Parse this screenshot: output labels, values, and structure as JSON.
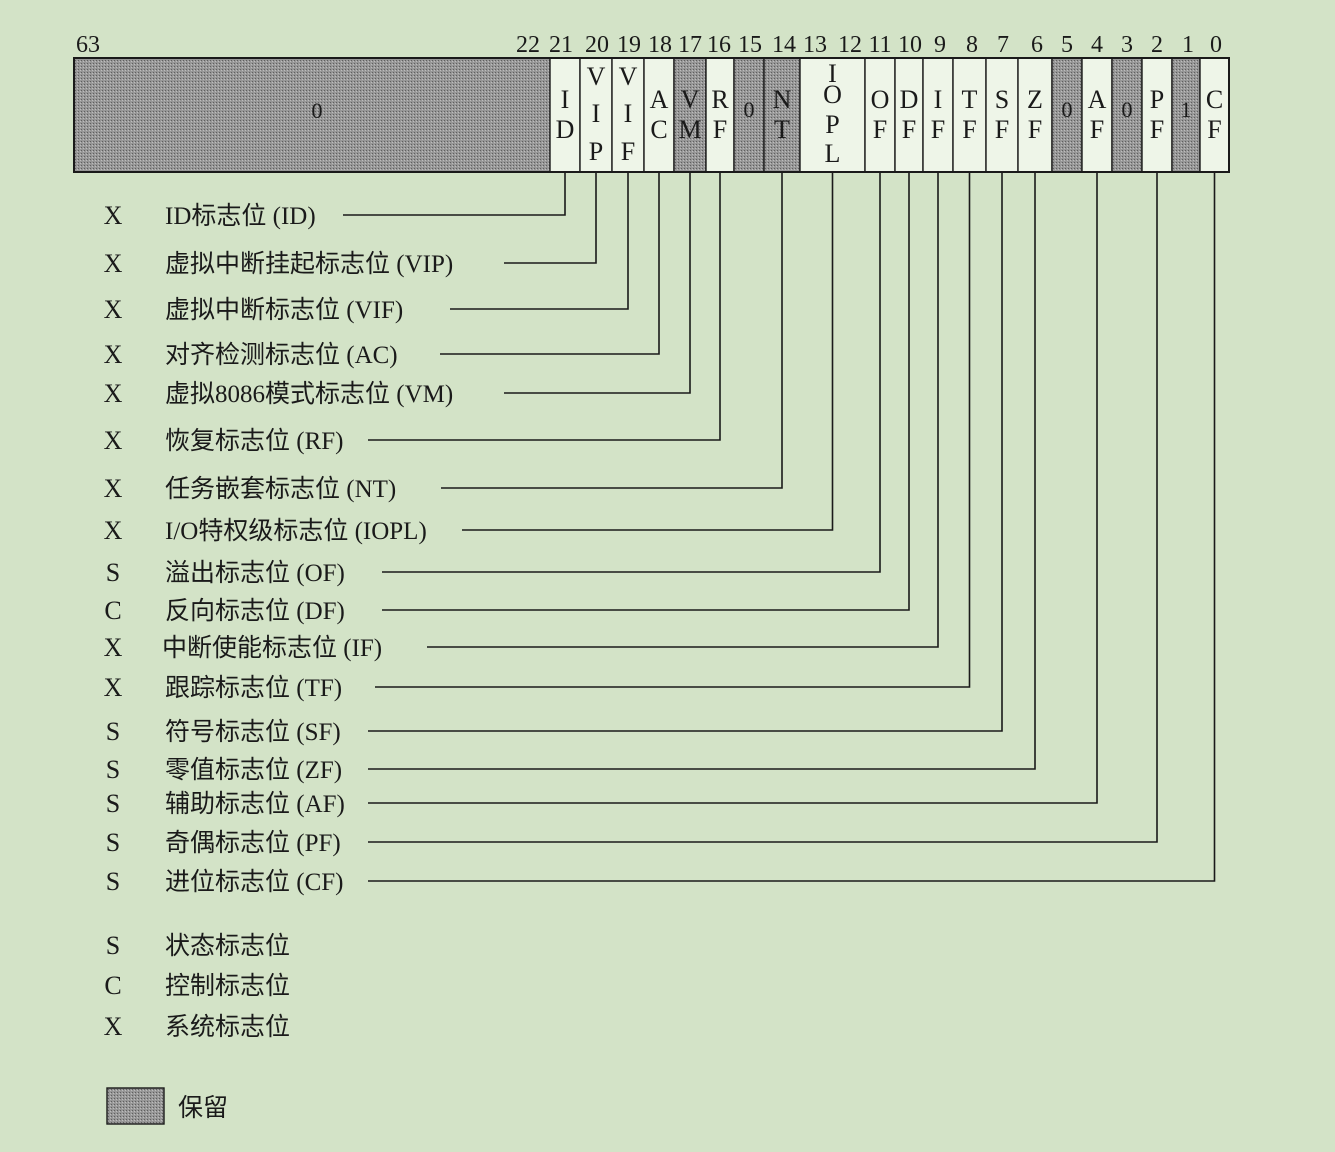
{
  "bit_numbers": [
    "63",
    "22",
    "21",
    "20",
    "19",
    "18",
    "17",
    "16",
    "15",
    "14",
    "13",
    "12",
    "11",
    "10",
    "9",
    "8",
    "7",
    "6",
    "5",
    "4",
    "3",
    "2",
    "1",
    "0"
  ],
  "register": {
    "reserved_high_value": "0",
    "fields": [
      {
        "letters": [
          "I",
          "D"
        ],
        "reserved": false
      },
      {
        "letters": [
          "V",
          "I",
          "P"
        ],
        "reserved": false
      },
      {
        "letters": [
          "V",
          "I",
          "F"
        ],
        "reserved": false
      },
      {
        "letters": [
          "A",
          "C"
        ],
        "reserved": false
      },
      {
        "letters": [
          "V",
          "M"
        ],
        "reserved": true
      },
      {
        "letters": [
          "R",
          "F"
        ],
        "reserved": false
      },
      {
        "letters": [
          "0"
        ],
        "reserved": true
      },
      {
        "letters": [
          "N",
          "T"
        ],
        "reserved": true
      },
      {
        "letters": [
          "I",
          "O",
          "P",
          "L"
        ],
        "reserved": false
      },
      {
        "letters": [
          "O",
          "F"
        ],
        "reserved": false
      },
      {
        "letters": [
          "D",
          "F"
        ],
        "reserved": false
      },
      {
        "letters": [
          "I",
          "F"
        ],
        "reserved": false
      },
      {
        "letters": [
          "T",
          "F"
        ],
        "reserved": false
      },
      {
        "letters": [
          "S",
          "F"
        ],
        "reserved": false
      },
      {
        "letters": [
          "Z",
          "F"
        ],
        "reserved": false
      },
      {
        "letters": [
          "0"
        ],
        "reserved": true
      },
      {
        "letters": [
          "A",
          "F"
        ],
        "reserved": false
      },
      {
        "letters": [
          "0"
        ],
        "reserved": true
      },
      {
        "letters": [
          "P",
          "F"
        ],
        "reserved": false
      },
      {
        "letters": [
          "1"
        ],
        "reserved": true
      },
      {
        "letters": [
          "C",
          "F"
        ],
        "reserved": false
      }
    ]
  },
  "flags": [
    {
      "type": "X",
      "label": "ID标志位 (ID)"
    },
    {
      "type": "X",
      "label": "虚拟中断挂起标志位 (VIP)"
    },
    {
      "type": "X",
      "label": "虚拟中断标志位 (VIF)"
    },
    {
      "type": "X",
      "label": "对齐检测标志位 (AC)"
    },
    {
      "type": "X",
      "label": "虚拟8086模式标志位 (VM)"
    },
    {
      "type": "X",
      "label": "恢复标志位 (RF)"
    },
    {
      "type": "X",
      "label": "任务嵌套标志位 (NT)"
    },
    {
      "type": "X",
      "label": "I/O特权级标志位 (IOPL)"
    },
    {
      "type": "S",
      "label": "溢出标志位 (OF)"
    },
    {
      "type": "C",
      "label": "反向标志位 (DF)"
    },
    {
      "type": "X",
      "label": "中断使能标志位 (IF)"
    },
    {
      "type": "X",
      "label": "跟踪标志位 (TF)"
    },
    {
      "type": "S",
      "label": "符号标志位 (SF)"
    },
    {
      "type": "S",
      "label": "零值标志位 (ZF)"
    },
    {
      "type": "S",
      "label": "辅助标志位 (AF)"
    },
    {
      "type": "S",
      "label": "奇偶标志位 (PF)"
    },
    {
      "type": "S",
      "label": "进位标志位 (CF)"
    }
  ],
  "legend": [
    {
      "type": "S",
      "label": "状态标志位"
    },
    {
      "type": "C",
      "label": "控制标志位"
    },
    {
      "type": "X",
      "label": "系统标志位"
    }
  ],
  "reserved_legend": "保留",
  "colors": {
    "background": "#d3e3c7",
    "cell": "#eef5e8",
    "reserved": "#8a8a8a",
    "line": "#1a1a1a"
  }
}
